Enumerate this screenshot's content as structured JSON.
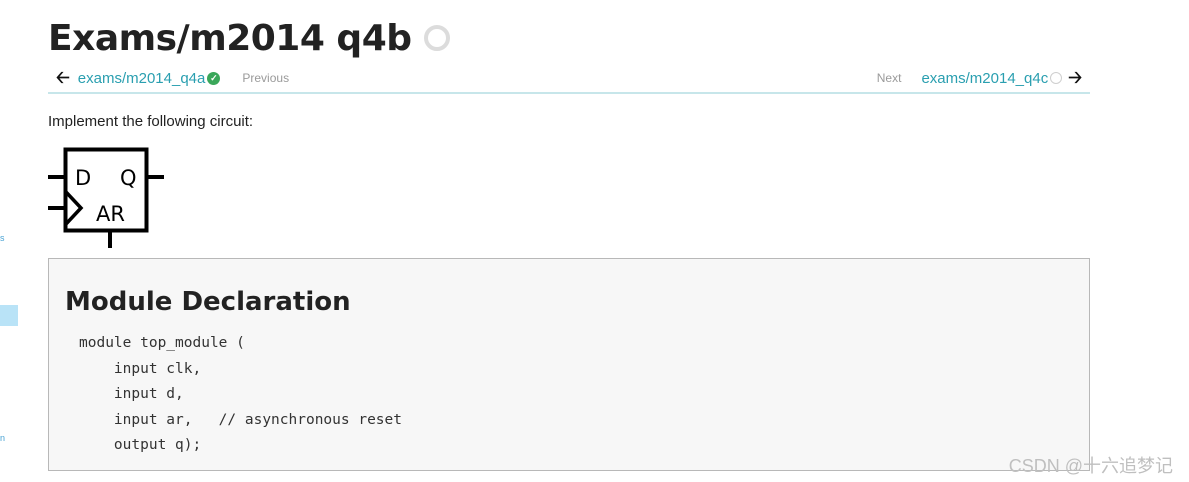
{
  "page": {
    "title": "Exams/m2014 q4b"
  },
  "nav": {
    "prev_link": "exams/m2014_q4a",
    "prev_label": "Previous",
    "next_label": "Next",
    "next_link": "exams/m2014_q4c"
  },
  "content": {
    "intro": "Implement the following circuit:",
    "circuit": {
      "d_label": "D",
      "q_label": "Q",
      "ar_label": "AR"
    }
  },
  "module": {
    "heading": "Module Declaration",
    "code": "module top_module (\n    input clk,\n    input d,\n    input ar,   // asynchronous reset\n    output q);"
  },
  "watermark": "CSDN @十六追梦记",
  "colors": {
    "link": "#2a9fb0",
    "check": "#3aa75a",
    "divider": "#c7e6ea",
    "code_bg": "#f7f7f7"
  }
}
